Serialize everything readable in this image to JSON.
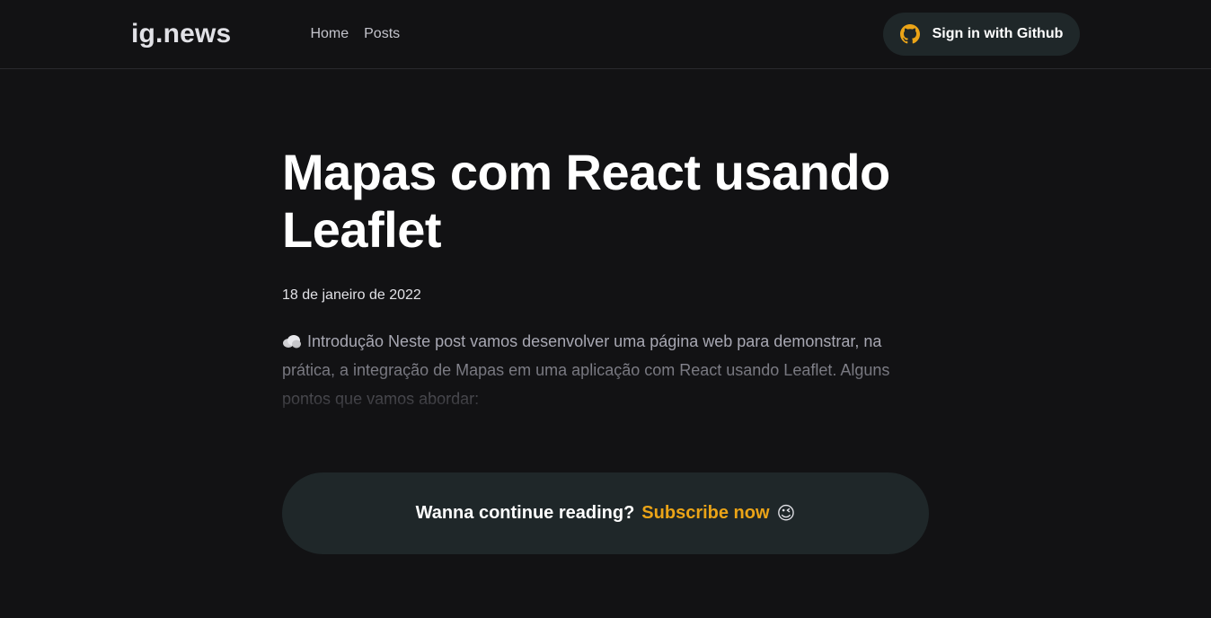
{
  "header": {
    "logo": "ig.news",
    "nav": [
      {
        "label": "Home"
      },
      {
        "label": "Posts"
      }
    ],
    "signin_label": "Sign in with Github"
  },
  "post": {
    "title": "Mapas com React usando Leaflet",
    "date": "18 de janeiro de 2022",
    "excerpt": "Introdução Neste post vamos desenvolver uma página web para demonstrar, na prática, a integração de Mapas em uma aplicação com React usando Leaflet. Alguns pontos que vamos abordar:"
  },
  "cta": {
    "question": "Wanna continue reading?",
    "link": "Subscribe now",
    "emoji": "😉"
  },
  "colors": {
    "background": "#121214",
    "accent": "#eba417",
    "panel": "#1f2729"
  }
}
